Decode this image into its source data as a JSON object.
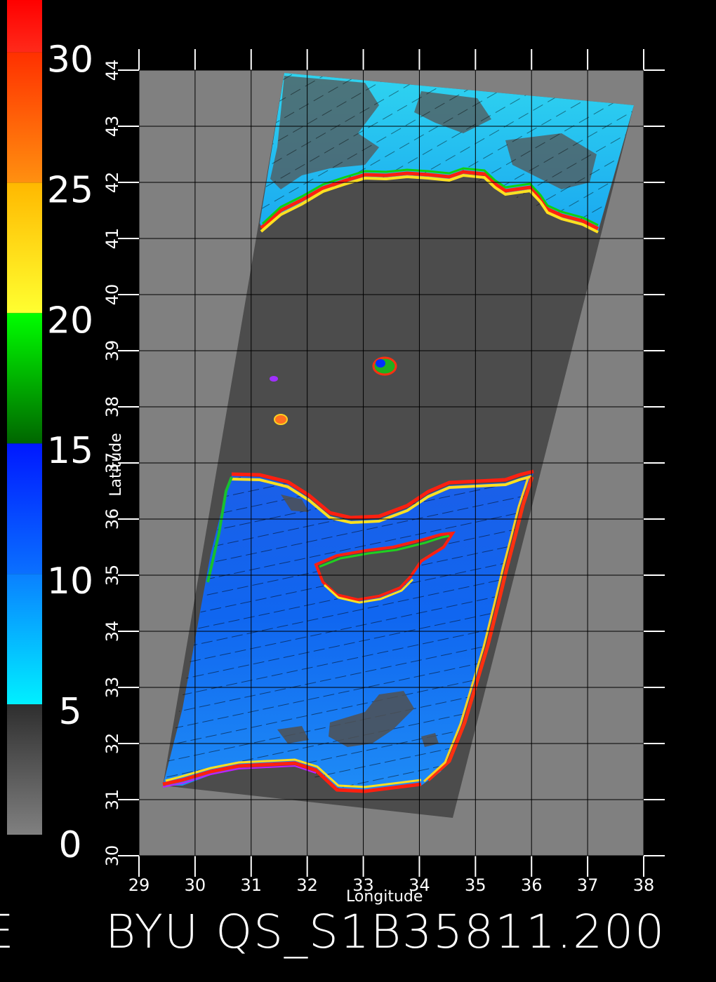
{
  "map": {
    "footer_text": "BYU QS_S1B35811.200",
    "footer_stray": "E",
    "x_axis_label": "Longitude",
    "y_axis_label": "Latitude",
    "x_ticks": [
      "29",
      "30",
      "31",
      "32",
      "33",
      "34",
      "35",
      "36",
      "37",
      "38"
    ],
    "y_ticks": [
      "30",
      "31",
      "32",
      "33",
      "34",
      "35",
      "36",
      "37",
      "38",
      "39",
      "40",
      "41",
      "42",
      "43",
      "44"
    ],
    "colorbar_ticks": [
      "0",
      "5",
      "10",
      "15",
      "20",
      "25",
      "30"
    ],
    "extent": {
      "lon": [
        29,
        38
      ],
      "lat": [
        30,
        44
      ]
    },
    "colorbar_range": [
      0,
      32
    ],
    "colors": {
      "background": "#000000",
      "no_data": "#808080",
      "land": "#4c4c4c",
      "grid": "#000000",
      "labels": "#ffffff"
    },
    "colorbar_bands": [
      {
        "from": 0,
        "to": 5,
        "color_a": "#808080",
        "color_b": "#2e2e2e"
      },
      {
        "from": 5,
        "to": 10,
        "color_a": "#00f0ff",
        "color_b": "#0a80ff"
      },
      {
        "from": 10,
        "to": 15,
        "color_a": "#0a70ff",
        "color_b": "#0018ff"
      },
      {
        "from": 15,
        "to": 20,
        "color_a": "#006600",
        "color_b": "#00ff00"
      },
      {
        "from": 20,
        "to": 25,
        "color_a": "#ffff30",
        "color_b": "#ffb800"
      },
      {
        "from": 25,
        "to": 30,
        "color_a": "#ff9010",
        "color_b": "#ff3000"
      },
      {
        "from": 30,
        "to": 32,
        "color_a": "#ff2a1a",
        "color_b": "#ff0000"
      }
    ]
  }
}
